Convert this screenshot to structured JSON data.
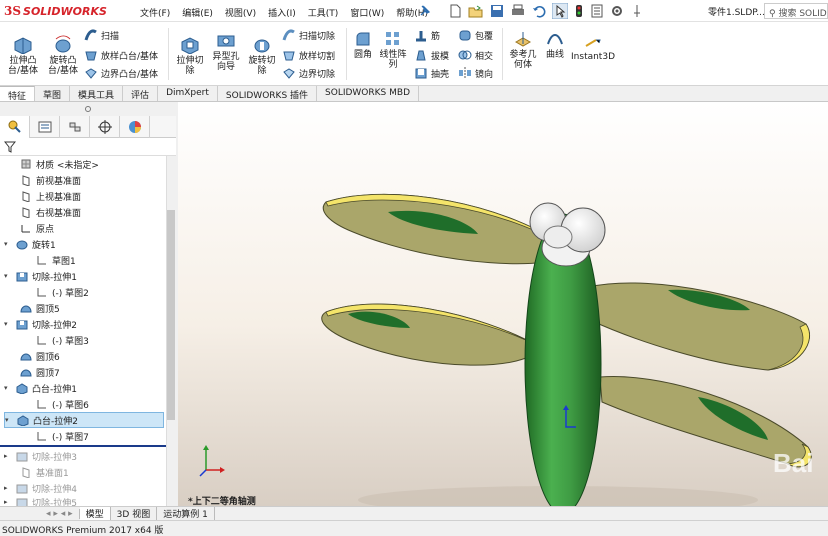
{
  "app": {
    "brand_prefix": "3S",
    "brand_name": "SOLIDWORKS"
  },
  "menu": [
    "文件(F)",
    "编辑(E)",
    "视图(V)",
    "插入(I)",
    "工具(T)",
    "窗口(W)",
    "帮助(H)"
  ],
  "document_title": "零件1.SLDP...",
  "search_placeholder": "搜索 SOLIDW",
  "ribbon": {
    "extrude_boss": "拉伸凸\n台/基体",
    "revolve_boss": "旋转凸\n台/基体",
    "sweep": "扫描",
    "loft": "放样凸台/基体",
    "boundary": "边界凸台/基体",
    "extrude_cut": "拉伸切\n除",
    "hole_wizard": "异型孔\n向导",
    "revolve_cut": "旋转切\n除",
    "swept_cut": "扫描切除",
    "lofted_cut": "放样切割",
    "boundary_cut": "边界切除",
    "fillet": "圆角",
    "linear_pattern": "线性阵\n列",
    "rib": "筋",
    "draft": "拔模",
    "shell": "抽壳",
    "wrap": "包覆",
    "intersect": "相交",
    "mirror": "镜向",
    "ref_geometry": "参考几\n何体",
    "curves": "曲线",
    "instant3d": "Instant3D"
  },
  "tabs": [
    "特征",
    "草图",
    "模具工具",
    "评估",
    "DimXpert",
    "SOLIDWORKS 插件",
    "SOLIDWORKS MBD"
  ],
  "active_tab": "特征",
  "tree": {
    "material": "材质 <未指定>",
    "items": [
      {
        "label": "前视基准面"
      },
      {
        "label": "上视基准面"
      },
      {
        "label": "右视基准面"
      },
      {
        "label": "原点"
      },
      {
        "label": "旋转1"
      },
      {
        "label": "草图1"
      },
      {
        "label": "切除-拉伸1"
      },
      {
        "label": "(-) 草图2"
      },
      {
        "label": "圆顶5"
      },
      {
        "label": "切除-拉伸2"
      },
      {
        "label": "(-) 草图3"
      },
      {
        "label": "圆顶6"
      },
      {
        "label": "圆顶7"
      },
      {
        "label": "凸台-拉伸1"
      },
      {
        "label": "(-) 草图6"
      },
      {
        "label": "凸台-拉伸2"
      },
      {
        "label": "(-) 草图7"
      },
      {
        "label": "切除-拉伸3"
      },
      {
        "label": "基准面1"
      },
      {
        "label": "切除-拉伸4"
      },
      {
        "label": "切除-拉伸5"
      }
    ]
  },
  "view_orientation": "*上下二等角轴测",
  "bottom_tabs": [
    "模型",
    "3D 视图",
    "运动算例 1"
  ],
  "active_bottom_tab": "模型",
  "status": "SOLIDWORKS Premium 2017 x64 版",
  "colors": {
    "brand": "#d6232a",
    "body_green": "#3fa34a",
    "wing": "#a8a86a",
    "wing_edge": "#f2e46a",
    "spot": "#1f6e2a",
    "selection": "#cde6f7"
  }
}
